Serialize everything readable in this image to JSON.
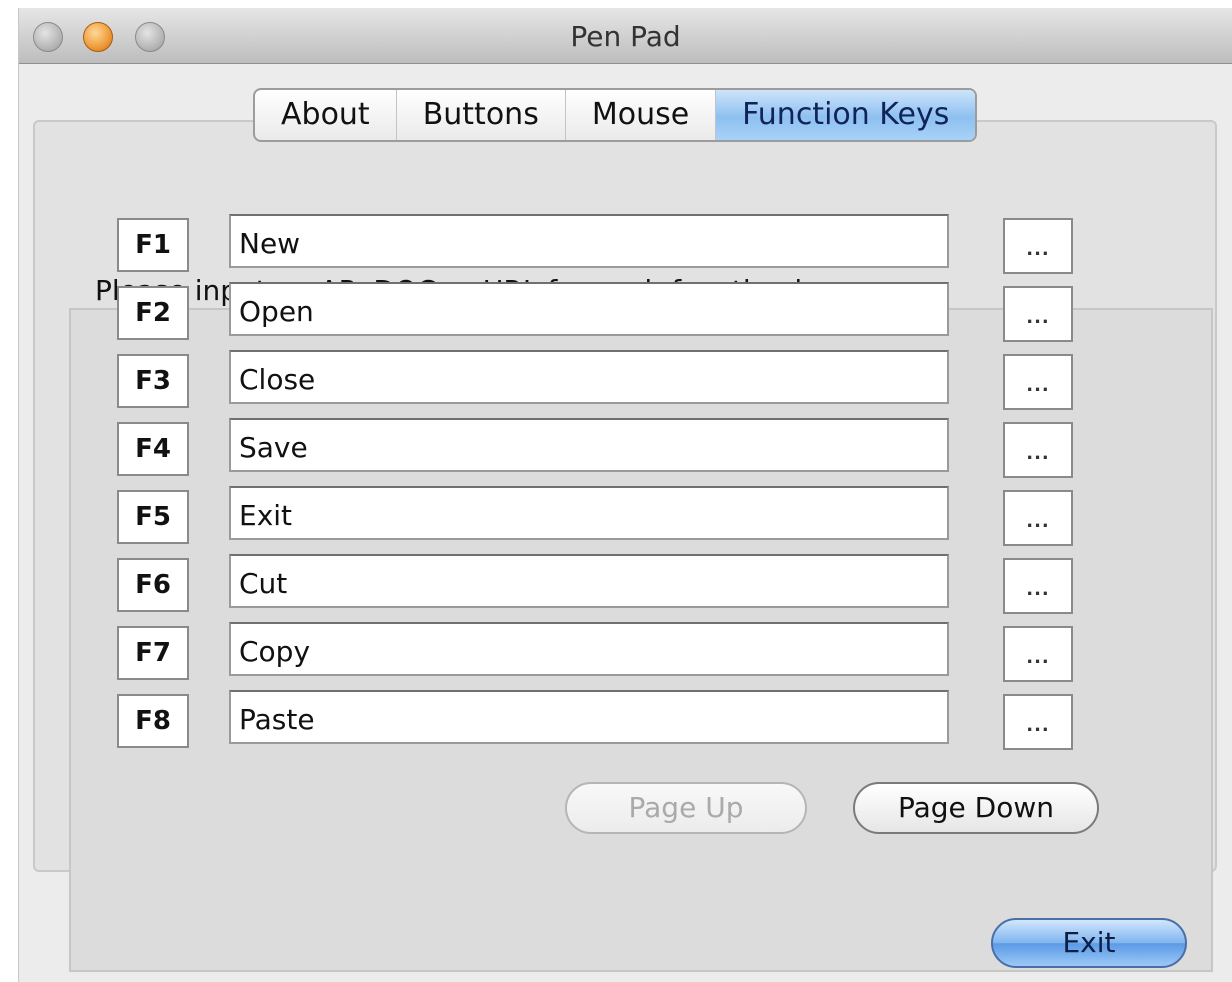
{
  "window": {
    "title": "Pen Pad"
  },
  "tabs": [
    {
      "label": "About",
      "active": false
    },
    {
      "label": "Buttons",
      "active": false
    },
    {
      "label": "Mouse",
      "active": false
    },
    {
      "label": "Function Keys",
      "active": true
    }
  ],
  "instruction": "Please input an AP, DOC or URL for each function key",
  "function_keys": [
    {
      "key": "F1",
      "value": "New",
      "browse_label": "..."
    },
    {
      "key": "F2",
      "value": "Open",
      "browse_label": "..."
    },
    {
      "key": "F3",
      "value": "Close",
      "browse_label": "..."
    },
    {
      "key": "F4",
      "value": "Save",
      "browse_label": "..."
    },
    {
      "key": "F5",
      "value": "Exit",
      "browse_label": "..."
    },
    {
      "key": "F6",
      "value": "Cut",
      "browse_label": "..."
    },
    {
      "key": "F7",
      "value": "Copy",
      "browse_label": "..."
    },
    {
      "key": "F8",
      "value": "Paste",
      "browse_label": "..."
    }
  ],
  "paging": {
    "page_up_label": "Page Up",
    "page_up_enabled": false,
    "page_down_label": "Page Down"
  },
  "footer": {
    "exit_label": "Exit"
  },
  "colors": {
    "active_tab": "#8ec0f0",
    "default_button": "#5a9ae6",
    "minimize_light": "#f0a040"
  }
}
